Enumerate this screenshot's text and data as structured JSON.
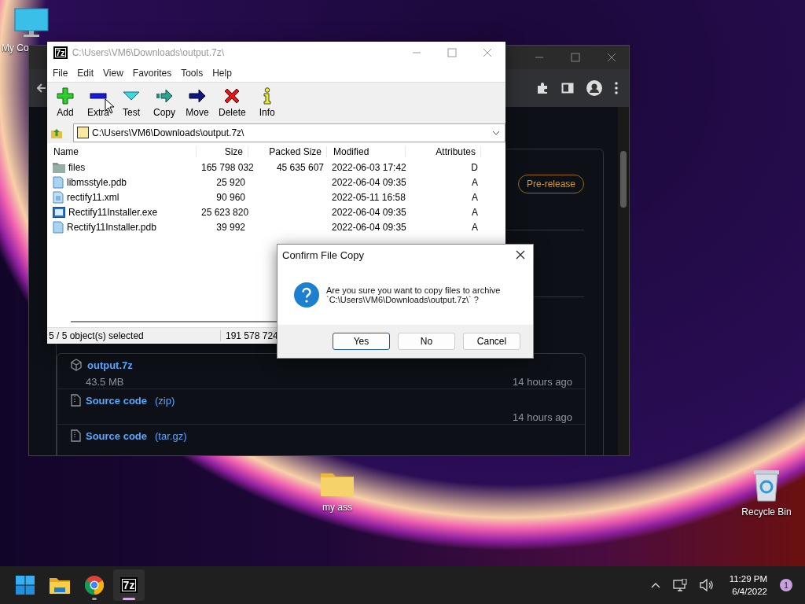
{
  "desktop_icons": [
    {
      "kind": "monitor",
      "label": "My Co"
    },
    {
      "kind": "folder",
      "label": "my ass"
    },
    {
      "kind": "recycle-bin",
      "label": "Recycle Bin"
    }
  ],
  "browser": {
    "badge": "Pre-release",
    "assets": [
      {
        "kind": "package",
        "name": "output.7z",
        "detail": "43.5 MB",
        "time": "14 hours ago"
      },
      {
        "kind": "archive",
        "name": "Source code",
        "format": "(zip)",
        "time": "14 hours ago"
      },
      {
        "kind": "archive",
        "name": "Source code",
        "format": "(tar.gz)"
      }
    ]
  },
  "archive_window": {
    "logo": "7z",
    "title": "C:\\Users\\VM6\\Downloads\\output.7z\\",
    "menu": [
      "File",
      "Edit",
      "View",
      "Favorites",
      "Tools",
      "Help"
    ],
    "toolbar": [
      {
        "kind": "add",
        "label": "Add"
      },
      {
        "kind": "extract",
        "label": "Extra"
      },
      {
        "kind": "test",
        "label": "Test"
      },
      {
        "kind": "copy",
        "label": "Copy"
      },
      {
        "kind": "move",
        "label": "Move"
      },
      {
        "kind": "delete",
        "label": "Delete"
      },
      {
        "kind": "info",
        "label": "Info"
      }
    ],
    "path": "C:\\Users\\VM6\\Downloads\\output.7z\\",
    "columns": [
      "Name",
      "Size",
      "Packed Size",
      "Modified",
      "Attributes"
    ],
    "rows": [
      {
        "kind": "folder",
        "name": "files",
        "size": "165 798 032",
        "packed_size": "45 635 607",
        "modified": "2022-06-03 17:42",
        "attributes": "D"
      },
      {
        "kind": "file",
        "name": "libmsstyle.pdb",
        "size": "25 920",
        "modified": "2022-06-04 09:35",
        "attributes": "A"
      },
      {
        "kind": "xml",
        "name": "rectify11.xml",
        "size": "90 960",
        "modified": "2022-05-11 16:58",
        "attributes": "A"
      },
      {
        "kind": "exe",
        "name": "Rectify11Installer.exe",
        "size": "25 623 820",
        "modified": "2022-06-04 09:35",
        "attributes": "A"
      },
      {
        "kind": "file",
        "name": "Rectify11Installer.pdb",
        "size": "39 992",
        "modified": "2022-06-04 09:35",
        "attributes": "A"
      }
    ],
    "status": {
      "selection": "5 / 5 object(s) selected",
      "total_size": "191 578 724"
    }
  },
  "dialog": {
    "title": "Confirm File Copy",
    "message": [
      "Are you sure you want to copy files to archive",
      "`C:\\Users\\VM6\\Downloads\\output.7z\\` ?"
    ],
    "buttons": [
      {
        "label": "Yes",
        "selected": true
      },
      {
        "label": "No",
        "selected": false
      },
      {
        "label": "Cancel",
        "selected": false
      }
    ]
  },
  "taskbar": {
    "apps": [
      {
        "kind": "start"
      },
      {
        "kind": "file-explorer",
        "running": false,
        "selected": false
      },
      {
        "kind": "chrome",
        "running": true,
        "selected": false
      },
      {
        "kind": "archiver",
        "label": "7z",
        "running": true,
        "selected": true
      }
    ],
    "time": "11:29 PM",
    "date": "6/4/2022",
    "notifications": "1"
  }
}
